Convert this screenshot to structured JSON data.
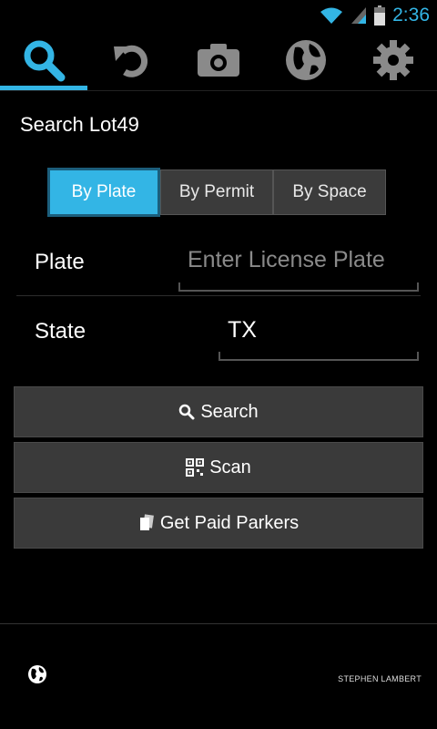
{
  "status": {
    "time": "2:36",
    "wifi_icon": "wifi-icon",
    "signal_icon": "signal-icon",
    "battery_icon": "battery-icon"
  },
  "tabs": [
    {
      "icon": "search-icon",
      "active": true
    },
    {
      "icon": "undo-icon",
      "active": false
    },
    {
      "icon": "camera-icon",
      "active": false
    },
    {
      "icon": "globe-icon",
      "active": false
    },
    {
      "icon": "gear-icon",
      "active": false
    }
  ],
  "heading": "Search Lot49",
  "mode": {
    "options": [
      "By Plate",
      "By Permit",
      "By Space"
    ],
    "selected": "By Plate"
  },
  "form": {
    "plate_label": "Plate",
    "plate_placeholder": "Enter License Plate",
    "plate_value": "",
    "state_label": "State",
    "state_value": "TX"
  },
  "actions": {
    "search": "Search",
    "scan": "Scan",
    "paid": "Get Paid Parkers"
  },
  "footer": {
    "author": "STEPHEN LAMBERT",
    "icon": "globe-icon"
  },
  "colors": {
    "accent": "#33b5e5",
    "button": "#3a3a3a"
  }
}
